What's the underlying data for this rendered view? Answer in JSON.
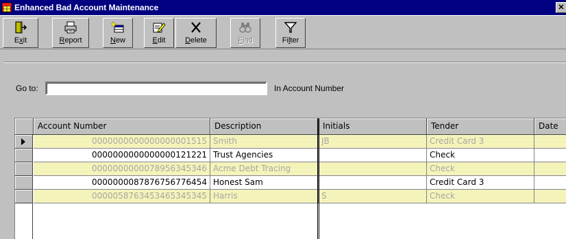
{
  "window": {
    "title": "Enhanced Bad Account Maintenance",
    "close_label": "✕",
    "colors": {
      "titlebar": "#000080",
      "face": "#c0c0c0",
      "highlight_row": "#fbfbd6",
      "muted_text": "#a8a8a8"
    }
  },
  "toolbar": {
    "exit": {
      "pre": "E",
      "key": "x",
      "post": "it",
      "icon": "exit-door-icon"
    },
    "report": {
      "pre": "",
      "key": "R",
      "post": "eport",
      "icon": "printer-icon"
    },
    "new": {
      "pre": "",
      "key": "N",
      "post": "ew",
      "icon": "new-record-icon"
    },
    "edit": {
      "pre": "",
      "key": "E",
      "post": "dit",
      "icon": "edit-pencil-icon"
    },
    "delete": {
      "pre": "",
      "key": "D",
      "post": "elete",
      "icon": "delete-x-icon"
    },
    "find": {
      "pre": "",
      "key": "F",
      "post": "ind",
      "icon": "binoculars-icon",
      "enabled": false
    },
    "filter": {
      "pre": "Fi",
      "key": "l",
      "post": "ter",
      "icon": "funnel-icon"
    }
  },
  "goto": {
    "label": "Go to:",
    "value": "",
    "hint": "In Account Number"
  },
  "grid": {
    "columns": [
      "Account Number",
      "Description",
      "Initials",
      "Tender",
      "Date"
    ],
    "rows": [
      {
        "account": "0000000000000000001515",
        "description": "Smith",
        "initials": "JB",
        "tender": "Credit Card 3",
        "date": "",
        "highlighted": true,
        "current": true
      },
      {
        "account": "0000000000000000121221",
        "description": "Trust Agencies",
        "initials": "",
        "tender": "Check",
        "date": "",
        "highlighted": false,
        "current": false
      },
      {
        "account": "0000000000078956345346",
        "description": "Acme Debt Tracing",
        "initials": "",
        "tender": "Check",
        "date": "",
        "highlighted": true,
        "current": false
      },
      {
        "account": "0000000087876756776454",
        "description": "Honest Sam",
        "initials": "",
        "tender": "Credit Card 3",
        "date": "",
        "highlighted": false,
        "current": false
      },
      {
        "account": "0000058763453465345345",
        "description": "Harris",
        "initials": "S",
        "tender": "Check",
        "date": "",
        "highlighted": true,
        "current": false
      }
    ]
  }
}
